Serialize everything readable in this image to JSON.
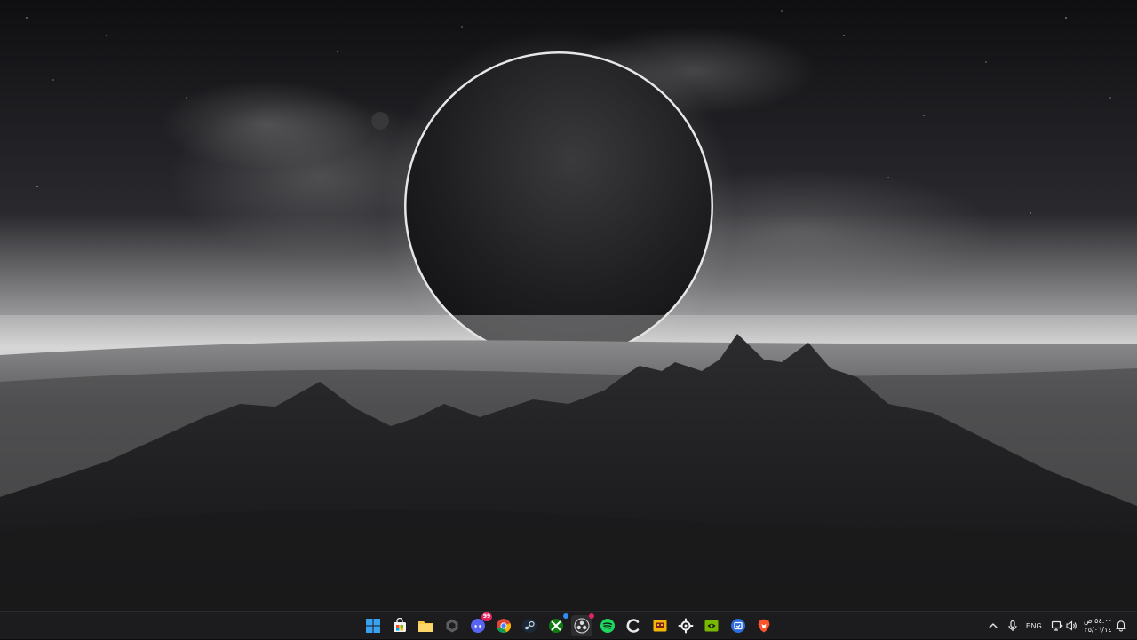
{
  "desktop": {
    "wallpaper": "dark-eclipse-mountains",
    "colors": {
      "sky_top": "#0f0f12",
      "horizon": "#cfcfcf",
      "mountain": "#262628"
    }
  },
  "taskbar": {
    "background": "#1c1c1e",
    "pinned_apps": [
      {
        "name": "start-button",
        "icon": "windows-logo-icon"
      },
      {
        "name": "microsoft-store",
        "icon": "store-icon"
      },
      {
        "name": "file-explorer",
        "icon": "folder-icon"
      },
      {
        "name": "app-hexagon",
        "icon": "hexagon-icon"
      },
      {
        "name": "discord",
        "icon": "discord-icon",
        "badge": "99"
      },
      {
        "name": "chrome",
        "icon": "chrome-icon"
      },
      {
        "name": "steam",
        "icon": "steam-icon"
      },
      {
        "name": "xbox",
        "icon": "xbox-icon",
        "badge": "•"
      },
      {
        "name": "obs-studio",
        "icon": "obs-icon",
        "badge": "•"
      },
      {
        "name": "spotify",
        "icon": "spotify-icon"
      },
      {
        "name": "ccleaner",
        "icon": "ccleaner-icon"
      },
      {
        "name": "app-yellow",
        "icon": "yellow-app-icon"
      },
      {
        "name": "app-gear",
        "icon": "gear-app-icon"
      },
      {
        "name": "nvidia",
        "icon": "nvidia-icon"
      },
      {
        "name": "app-blue",
        "icon": "blue-app-icon"
      },
      {
        "name": "brave",
        "icon": "brave-icon"
      }
    ],
    "tray": {
      "chevron": "chevron-up-icon",
      "microphone": "microphone-icon",
      "language": "ENG",
      "network": "network-icon",
      "volume": "volume-icon",
      "clock": {
        "time": "٥٤:٠٠ ص",
        "date": "٢٥/٠٦/١٤"
      },
      "notifications": "notification-icon"
    }
  }
}
